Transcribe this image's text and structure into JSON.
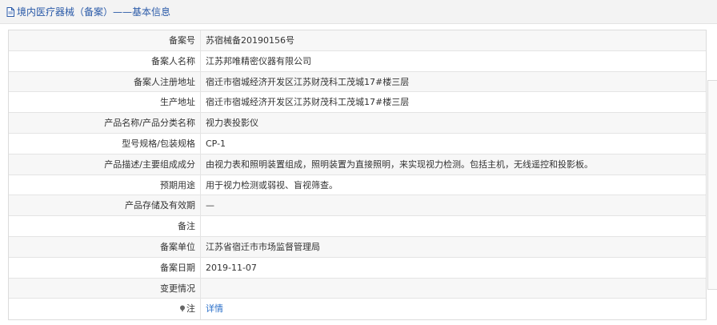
{
  "header": {
    "title": "境内医疗器械（备案）——基本信息"
  },
  "rows": [
    {
      "label": "备案号",
      "value": "苏宿械备20190156号"
    },
    {
      "label": "备案人名称",
      "value": "江苏邦唯精密仪器有限公司"
    },
    {
      "label": "备案人注册地址",
      "value": "宿迁市宿城经济开发区江苏财茂科工茂城17#楼三层"
    },
    {
      "label": "生产地址",
      "value": "宿迁市宿城经济开发区江苏财茂科工茂城17#楼三层"
    },
    {
      "label": "产品名称/产品分类名称",
      "value": "视力表投影仪"
    },
    {
      "label": "型号规格/包装规格",
      "value": "CP-1"
    },
    {
      "label": "产品描述/主要组成成分",
      "value": "由视力表和照明装置组成，照明装置为直接照明，来实现视力检测。包括主机，无线遥控和投影板。"
    },
    {
      "label": "预期用途",
      "value": "用于视力检测或弱视、盲视筛查。"
    },
    {
      "label": "产品存储及有效期",
      "value": "—"
    },
    {
      "label": "备注",
      "value": ""
    },
    {
      "label": "备案单位",
      "value": "江苏省宿迁市市场监督管理局"
    },
    {
      "label": "备案日期",
      "value": "2019-11-07"
    },
    {
      "label": "变更情况",
      "value": ""
    },
    {
      "label": "注",
      "value": "详情"
    }
  ],
  "icons": {
    "header": "document-icon",
    "note": "pin-icon"
  },
  "colors": {
    "title": "#2a5aa8",
    "link": "#2a6fc9"
  }
}
